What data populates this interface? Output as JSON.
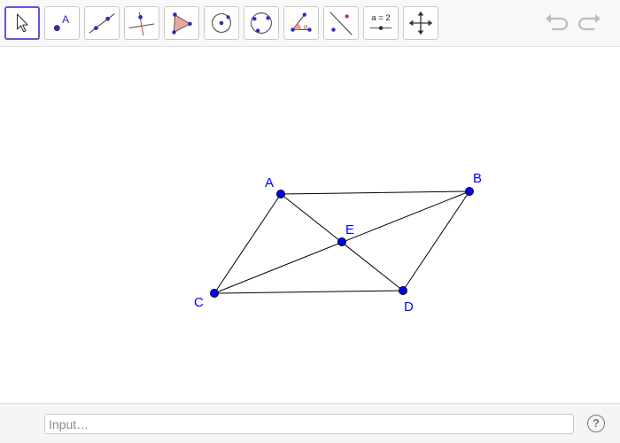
{
  "toolbar": {
    "tools": [
      {
        "name": "move-tool",
        "selected": true
      },
      {
        "name": "point-tool",
        "label": "A"
      },
      {
        "name": "line-tool"
      },
      {
        "name": "perpendicular-line-tool"
      },
      {
        "name": "polygon-tool"
      },
      {
        "name": "circle-center-point-tool"
      },
      {
        "name": "circle-three-points-tool"
      },
      {
        "name": "angle-tool"
      },
      {
        "name": "reflect-tool"
      },
      {
        "name": "slider-tool",
        "label": "a = 2"
      },
      {
        "name": "move-graphics-view-tool"
      }
    ],
    "undo_icon": "undo-icon",
    "redo_icon": "redo-icon"
  },
  "colors": {
    "point_fill": "#0000ff",
    "label": "#0000ff",
    "segment": "#000000",
    "selected_tool_border": "#6557d2",
    "polygon_icon_fill": "#e8a8a0"
  },
  "construction": {
    "points": [
      {
        "label": "A"
      },
      {
        "label": "B"
      },
      {
        "label": "C"
      },
      {
        "label": "D"
      },
      {
        "label": "E"
      }
    ],
    "segments": [
      "AB",
      "CD",
      "AC",
      "BD",
      "AD",
      "CB"
    ]
  },
  "input_bar": {
    "placeholder": "Input…",
    "help_label": "?"
  }
}
